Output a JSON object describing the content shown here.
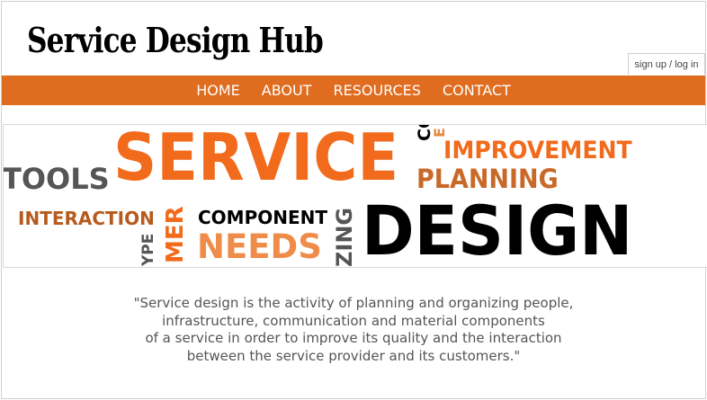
{
  "site": {
    "title": "Service Design Hub",
    "auth_label": "sign up / log in"
  },
  "nav": {
    "items": [
      "HOME",
      "ABOUT",
      "RESOURCES",
      "CONTACT"
    ]
  },
  "banner": {
    "words": {
      "service": "SERVICE",
      "tools": "TOOLS",
      "co": "CO",
      "e": "E",
      "improvement": "IMPROVEMENT",
      "planning": "PLANNING",
      "interaction": "INTERACTION",
      "mer": "MER",
      "component": "COMPONENT",
      "zing": "ZING",
      "design": "DESIGN",
      "needs": "NEEDS",
      "ype": "YPE"
    },
    "colors": {
      "orange": "#f26a1b",
      "brown": "#b65a1d",
      "gray": "#555555",
      "black": "#000000",
      "tan": "#e58a3c"
    }
  },
  "quote": {
    "lines": [
      "\"Service design is the activity of planning and organizing people,",
      "infrastructure, communication and material components",
      "of a service in order to improve its quality and the interaction",
      "between the service provider and its customers.\""
    ]
  },
  "theme": {
    "nav_bg": "#e06c1f"
  }
}
